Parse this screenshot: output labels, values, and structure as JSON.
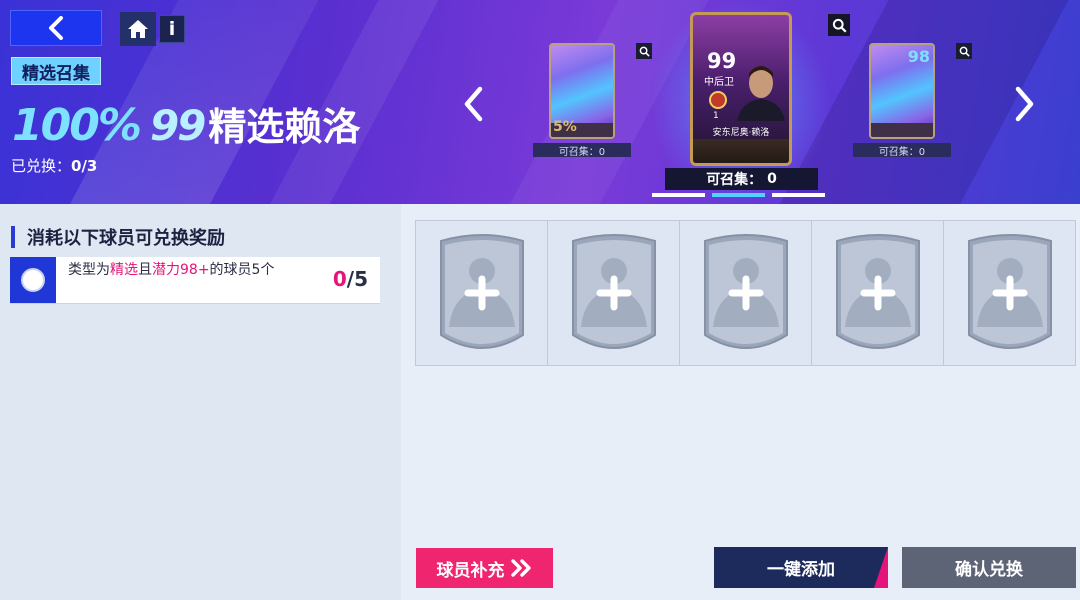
{
  "header": {
    "tag": "精选召集",
    "headline": {
      "percent": "100%",
      "rating": "99",
      "name": "精选赖洛"
    },
    "redeemed_label": "已兑换：",
    "redeemed_value": "0/3"
  },
  "carousel": {
    "left_card": {
      "badge": "5%",
      "collect": "可召集：0"
    },
    "main_card": {
      "rating": "99",
      "position": "中后卫",
      "number": "1",
      "player_name": "安东尼奥·赖洛",
      "collect_label": "可召集：",
      "collect_value": "0"
    },
    "right_card": {
      "rating": "98",
      "collect": "可召集：0"
    },
    "page_count": 3,
    "active_page": 1
  },
  "requirements": {
    "title": "消耗以下球员可兑换奖励",
    "row": {
      "text_prefix": "类型为",
      "type": "精选",
      "text_mid": "且",
      "condition": "潜力98+",
      "text_suffix": "的球员5个",
      "count_current": "0",
      "count_total": "/5"
    }
  },
  "slots": [
    {
      "state": "empty"
    },
    {
      "state": "empty"
    },
    {
      "state": "empty"
    },
    {
      "state": "empty"
    },
    {
      "state": "empty"
    }
  ],
  "buttons": {
    "supplement": "球员补充",
    "one_click_add": "一键添加",
    "confirm": "确认兑换"
  },
  "icons": {
    "back": "chevron-left-icon",
    "home": "home-icon",
    "info": "info-icon",
    "zoom": "magnifier-icon",
    "carousel_prev": "chevron-left-icon",
    "carousel_next": "chevron-right-icon",
    "add": "plus-icon",
    "double_chevron": "double-chevron-right-icon"
  },
  "colors": {
    "accent_pink": "#e5147a",
    "accent_blue": "#1e37d6",
    "header_purple": "#5a2fd0"
  }
}
